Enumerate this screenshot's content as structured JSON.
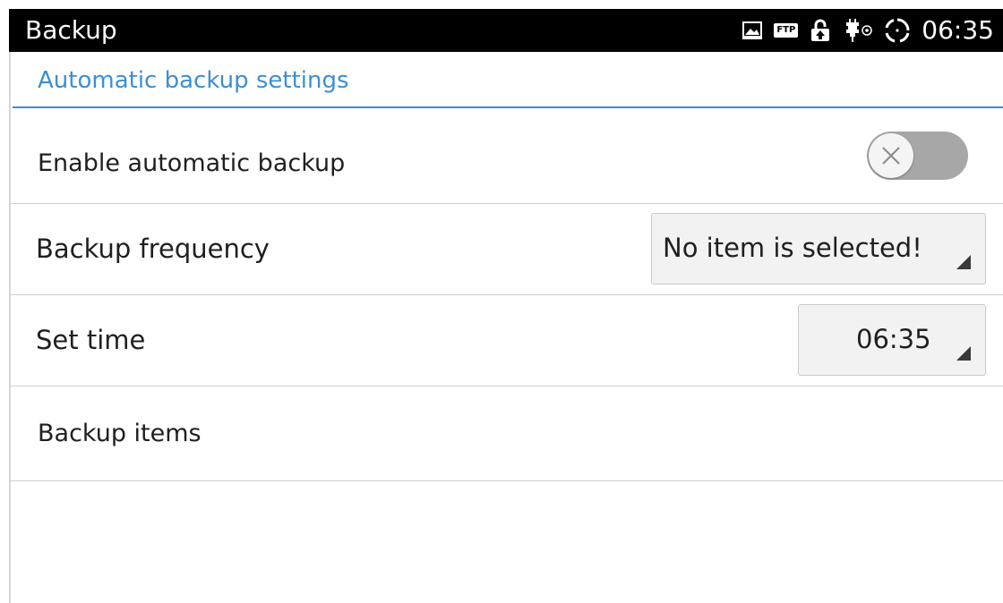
{
  "status_bar": {
    "title": "Backup",
    "time": "06:35",
    "ftp_label": "FTP",
    "icons": [
      "image-icon",
      "ftp-icon",
      "lock-icon",
      "usb-debug-icon",
      "sync-icon"
    ]
  },
  "section": {
    "title": "Automatic backup settings",
    "accent_color": "#3d8fd1"
  },
  "settings": {
    "enable_backup": {
      "label": "Enable automatic backup",
      "enabled": false
    },
    "frequency": {
      "label": "Backup frequency",
      "value": "No item is selected!"
    },
    "set_time": {
      "label": "Set time",
      "value": "06:35"
    },
    "backup_items": {
      "label": "Backup items"
    }
  }
}
